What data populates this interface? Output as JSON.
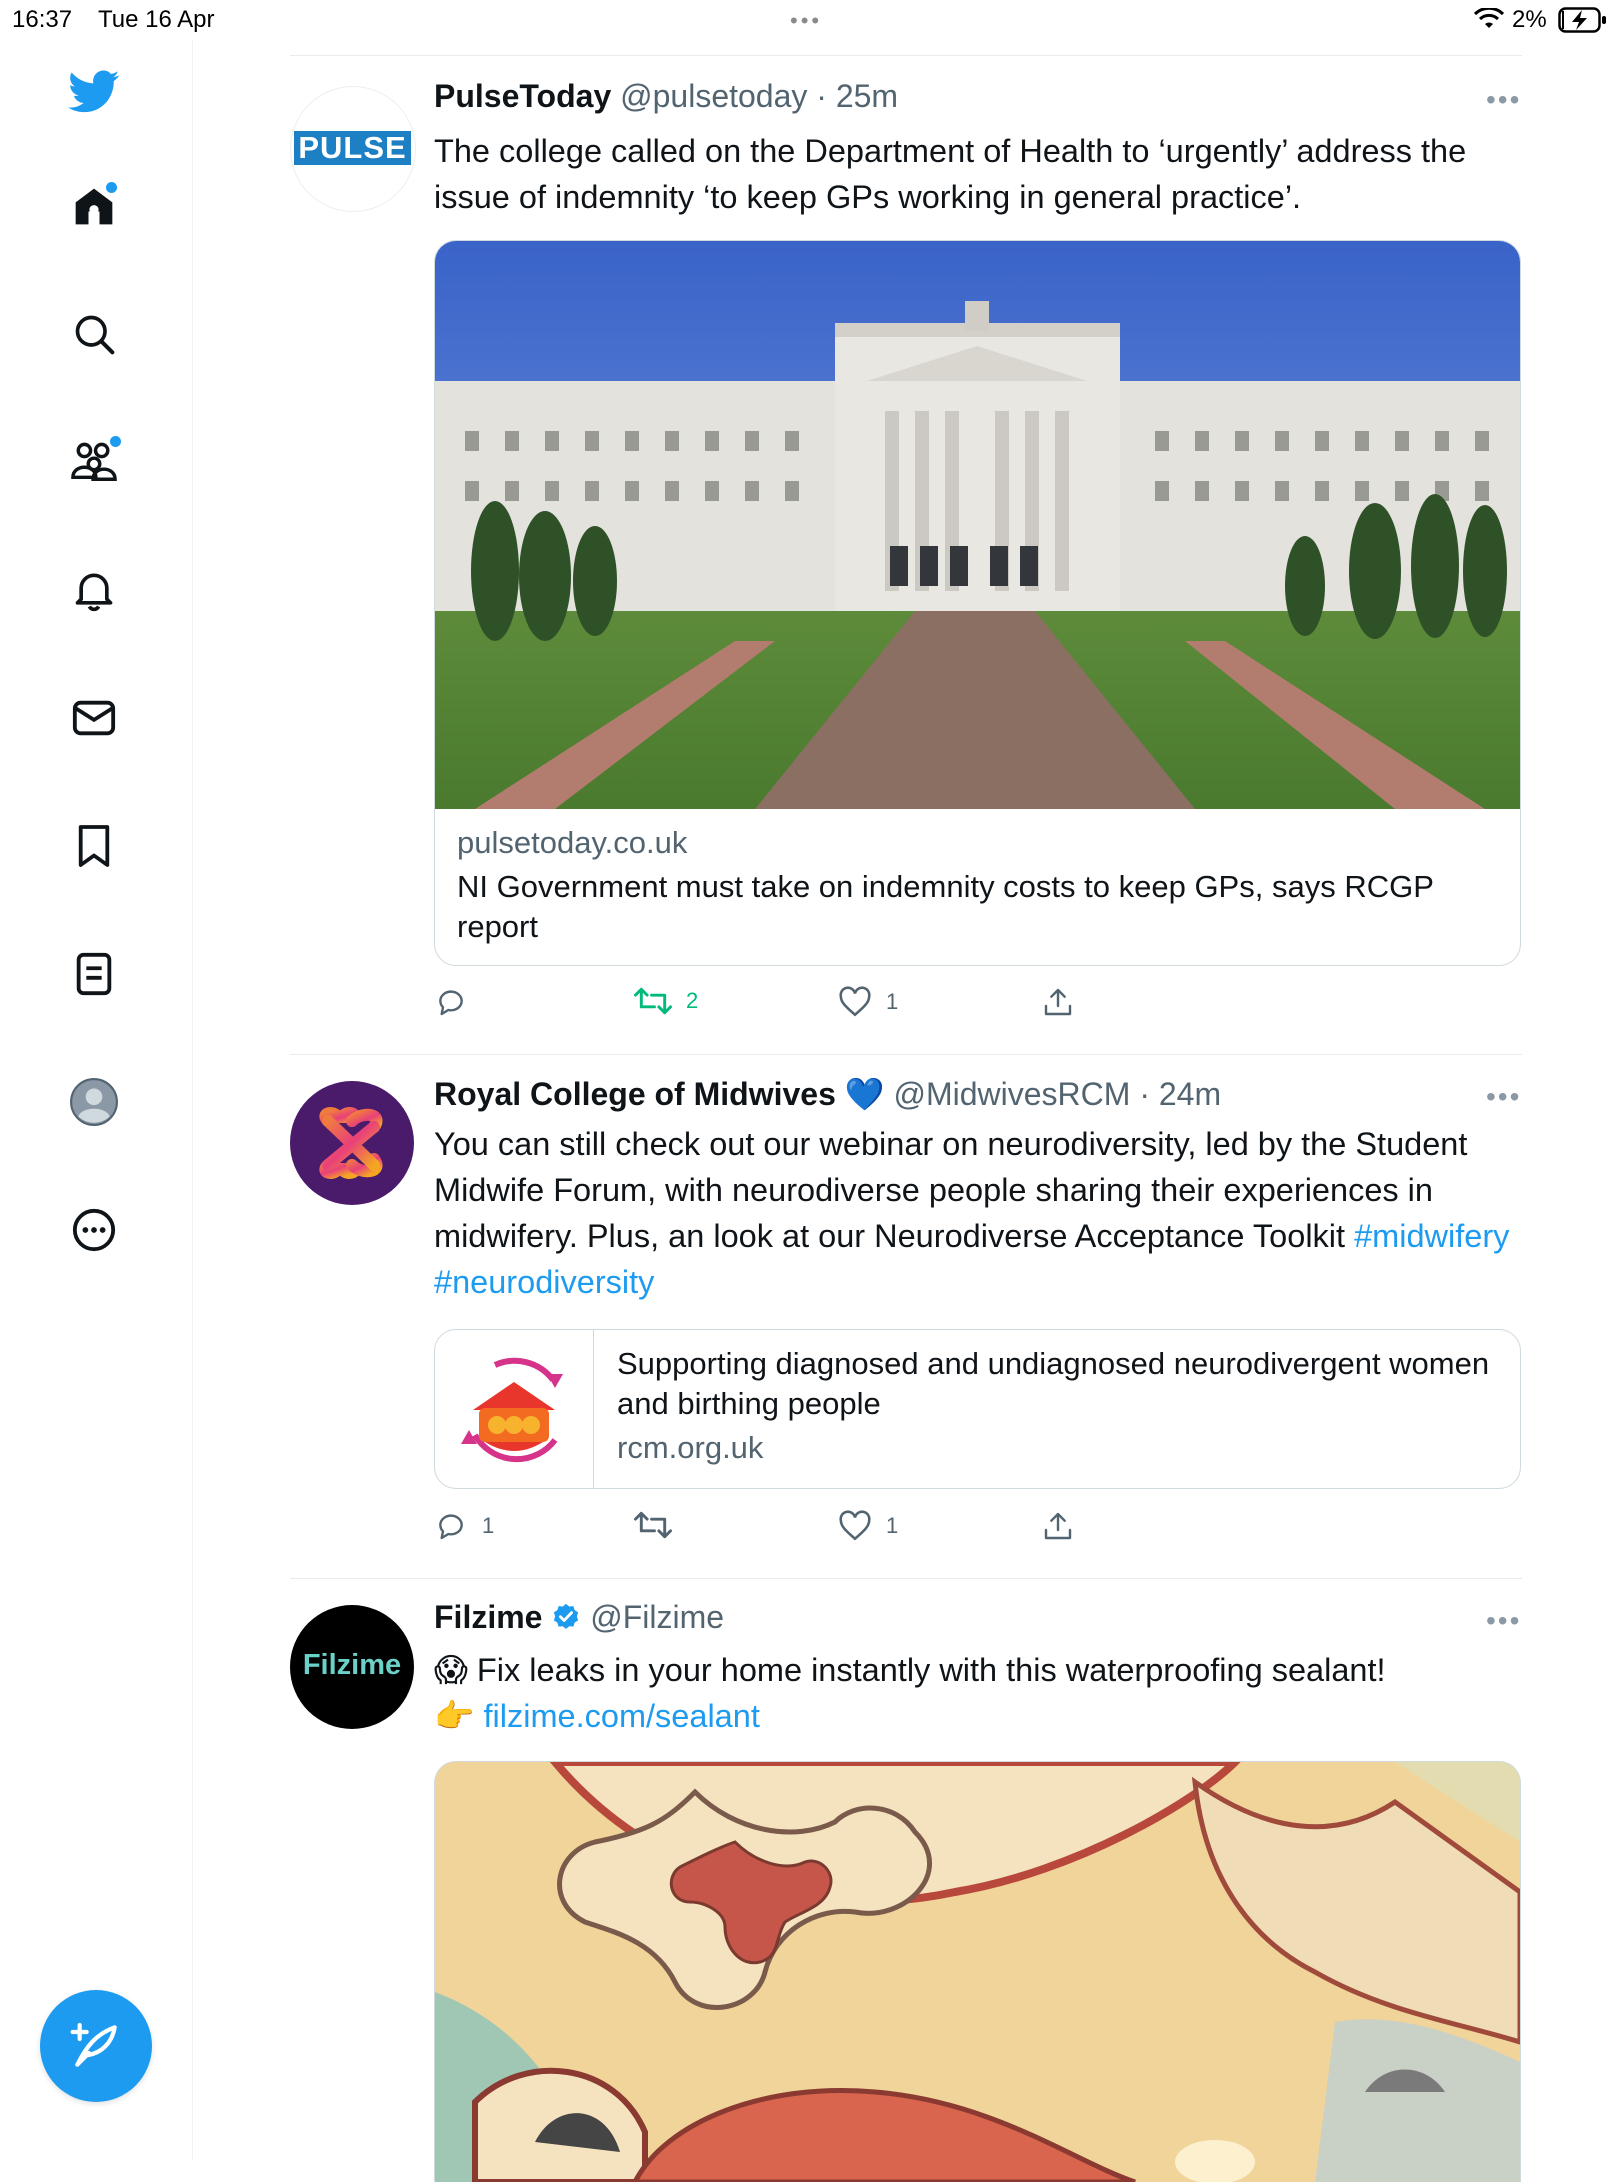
{
  "status_bar": {
    "time": "16:37",
    "date": "Tue 16 Apr",
    "battery": "2%"
  },
  "sidebar": {
    "items": [
      {
        "name": "home"
      },
      {
        "name": "search"
      },
      {
        "name": "communities"
      },
      {
        "name": "notifications"
      },
      {
        "name": "messages"
      },
      {
        "name": "bookmarks"
      },
      {
        "name": "lists"
      },
      {
        "name": "profile"
      },
      {
        "name": "more"
      }
    ]
  },
  "tweets": [
    {
      "name": "PulseToday",
      "handle": "@pulsetoday",
      "time": "25m",
      "avatar_text": "PULSE",
      "text": "The college called on the Department of Health to ‘urgently’ address the issue of indemnity ‘to keep GPs working in general practice’.",
      "card": {
        "domain": "pulsetoday.co.uk",
        "title": "NI Government must take on indemnity costs to keep GPs, says RCGP report"
      },
      "actions": {
        "replies": "",
        "retweets": "2",
        "likes": "1"
      }
    },
    {
      "name": "Royal College of Midwives",
      "name_emoji": "💙",
      "handle": "@MidwivesRCM",
      "time": "24m",
      "text": "You can still check out our webinar on neurodiversity, led by the Student Midwife Forum, with neurodiverse people sharing their experiences in midwifery. Plus, an look at our Neurodiverse Acceptance Toolkit",
      "hashtags": [
        "#midwifery",
        "#neurodiversity"
      ],
      "card": {
        "title": "Supporting diagnosed and undiagnosed neurodivergent women and birthing people",
        "domain": "rcm.org.uk"
      },
      "actions": {
        "replies": "1",
        "retweets": "",
        "likes": "1"
      }
    },
    {
      "name": "Filzime",
      "handle": "@Filzime",
      "avatar_text": "Filzime",
      "line1_emoji": "😱",
      "line1": "Fix leaks in your home instantly with this waterproofing sealant!",
      "line2_emoji": "👉",
      "line2_link": "filzime.com/sealant"
    }
  ],
  "colors": {
    "accent": "#1d9bf0",
    "retweet_active": "#00ba7c",
    "text_secondary": "#536471"
  }
}
